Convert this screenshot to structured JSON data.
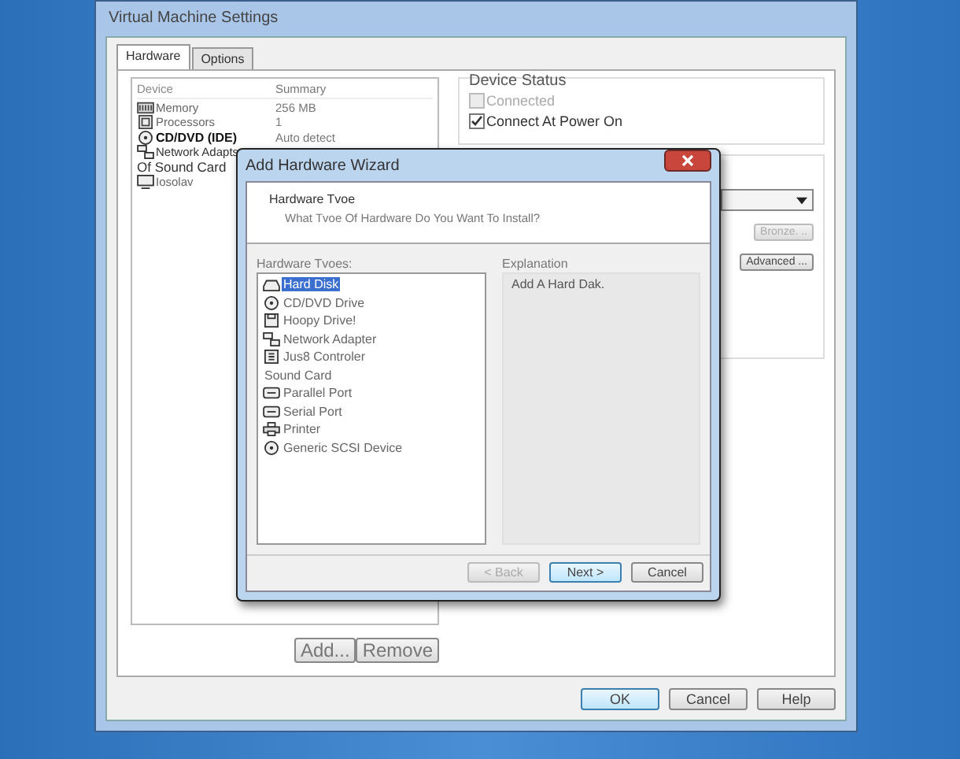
{
  "window": {
    "title": "Virtual Machine Settings"
  },
  "tabs": [
    {
      "label": "Hardware",
      "selected": true
    },
    {
      "label": "Options",
      "selected": false
    }
  ],
  "device_list": {
    "columns": [
      "Device",
      "Summary"
    ],
    "rows": [
      {
        "kind": "memory",
        "device": "Memory",
        "summary": "256 MB"
      },
      {
        "kind": "processor",
        "device": "Processors",
        "summary": "1"
      },
      {
        "kind": "disc",
        "device": "CD/DVD (IDE)",
        "summary": "Auto detect"
      },
      {
        "kind": "network",
        "device": "Network Adapts",
        "summary": ""
      },
      {
        "kind": "none",
        "device": "Of Sound Card",
        "summary": ""
      },
      {
        "kind": "display",
        "device": "Iosolav",
        "summary": ""
      }
    ]
  },
  "device_status": {
    "title": "Device Status",
    "options": [
      {
        "label": "Connected",
        "checked": false,
        "disabled": true
      },
      {
        "label": "Connect At Power On",
        "checked": true,
        "disabled": false
      }
    ]
  },
  "connection": {
    "browse_button": "Bronze. ..",
    "advanced_button": "Advanced ..."
  },
  "list_buttons": [
    "Add...",
    "Remove"
  ],
  "footer_buttons": [
    {
      "label": "OK",
      "default": true
    },
    {
      "label": "Cancel",
      "default": false
    },
    {
      "label": "Help",
      "default": false
    }
  ],
  "wizard": {
    "title": "Add Hardware Wizard",
    "heading": "Hardware Tvoe",
    "subheading": "What Tvoe Of Hardware Do You Want To Install?",
    "list_label": "Hardware Tvoes:",
    "types": [
      {
        "kind": "disk",
        "label": "Hard Disk",
        "selected": true
      },
      {
        "kind": "disc",
        "label": "CD/DVD Drive",
        "selected": false
      },
      {
        "kind": "floppy",
        "label": "Hoopy Drive!",
        "selected": false
      },
      {
        "kind": "network",
        "label": "Network Adapter",
        "selected": false
      },
      {
        "kind": "usb",
        "label": "Jus8 Controler",
        "selected": false
      },
      {
        "kind": "none",
        "label": "Sound Card",
        "selected": false
      },
      {
        "kind": "port",
        "label": "Parallel Port",
        "selected": false
      },
      {
        "kind": "port",
        "label": "Serial Port",
        "selected": false
      },
      {
        "kind": "printer",
        "label": "Printer",
        "selected": false
      },
      {
        "kind": "disc",
        "label": "Generic SCSI Device",
        "selected": false
      }
    ],
    "explanation_label": "Explanation",
    "explanation": "Add A Hard Dak.",
    "buttons": [
      {
        "label": "< Back",
        "disabled": true,
        "default": false
      },
      {
        "label": "Next >",
        "disabled": false,
        "default": true
      },
      {
        "label": "Cancel",
        "disabled": false,
        "default": false
      }
    ]
  }
}
